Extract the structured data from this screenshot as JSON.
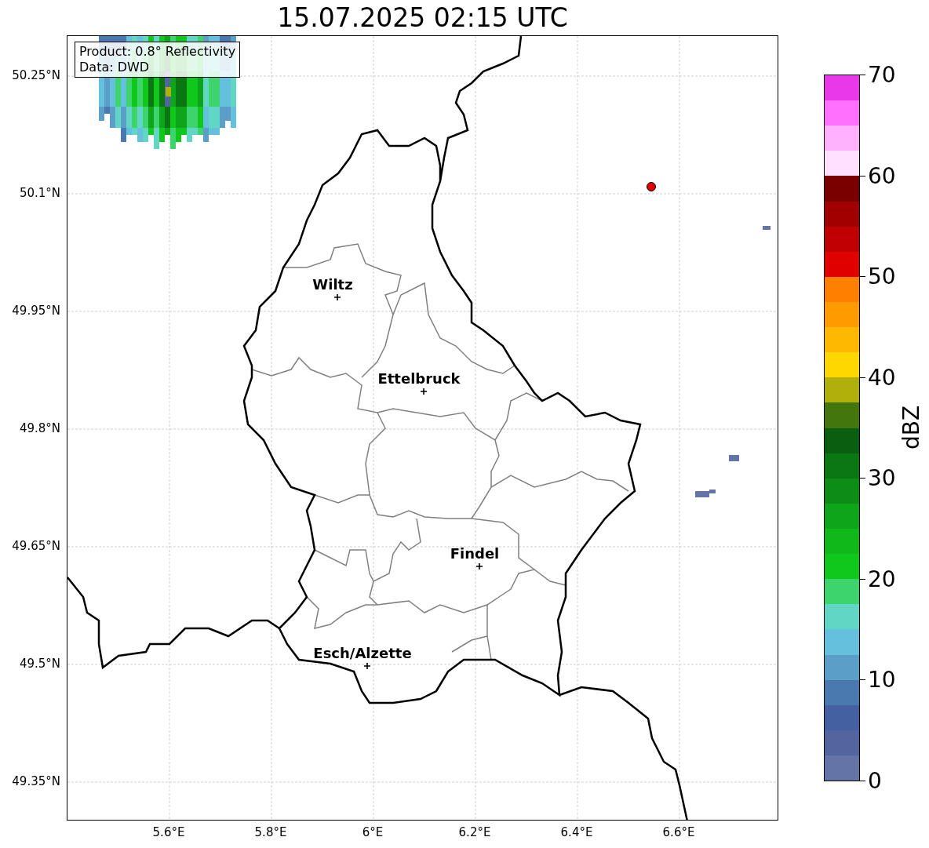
{
  "title": "15.07.2025 02:15 UTC",
  "map": {
    "x_ticks": [
      "5.6°E",
      "5.8°E",
      "6°E",
      "6.2°E",
      "6.4°E",
      "6.6°E"
    ],
    "y_ticks": [
      "50.25°N",
      "50.1°N",
      "49.95°N",
      "49.8°N",
      "49.65°N",
      "49.5°N",
      "49.35°N"
    ],
    "legend": [
      "Product: 0.8° Reflectivity",
      "Data: DWD"
    ],
    "cities": [
      {
        "name": "Wiltz"
      },
      {
        "name": "Ettelbruck"
      },
      {
        "name": "Findel"
      },
      {
        "name": "Esch/Alzette"
      }
    ]
  },
  "colorbar": {
    "label": "dBZ",
    "ticks": [
      "70",
      "60",
      "50",
      "40",
      "30",
      "20",
      "10",
      "0"
    ],
    "bands": [
      {
        "color": "#e838e8"
      },
      {
        "color": "#ff70ff"
      },
      {
        "color": "#ffb0ff"
      },
      {
        "color": "#ffe0ff"
      },
      {
        "color": "#7a0000"
      },
      {
        "color": "#a00000"
      },
      {
        "color": "#c00000"
      },
      {
        "color": "#e00000"
      },
      {
        "color": "#ff7f00"
      },
      {
        "color": "#ff9b00"
      },
      {
        "color": "#ffb800"
      },
      {
        "color": "#ffd700"
      },
      {
        "color": "#b0b00a"
      },
      {
        "color": "#44760e"
      },
      {
        "color": "#0a5e10"
      },
      {
        "color": "#0b7713"
      },
      {
        "color": "#0d8c18"
      },
      {
        "color": "#0ea51a"
      },
      {
        "color": "#10b81a"
      },
      {
        "color": "#10c81c"
      },
      {
        "color": "#3dd46e"
      },
      {
        "color": "#61d6c4"
      },
      {
        "color": "#64c0dc"
      },
      {
        "color": "#5b9fc8"
      },
      {
        "color": "#4a79b0"
      },
      {
        "color": "#4560a0"
      },
      {
        "color": "#52659f"
      },
      {
        "color": "#6474a6"
      }
    ]
  }
}
